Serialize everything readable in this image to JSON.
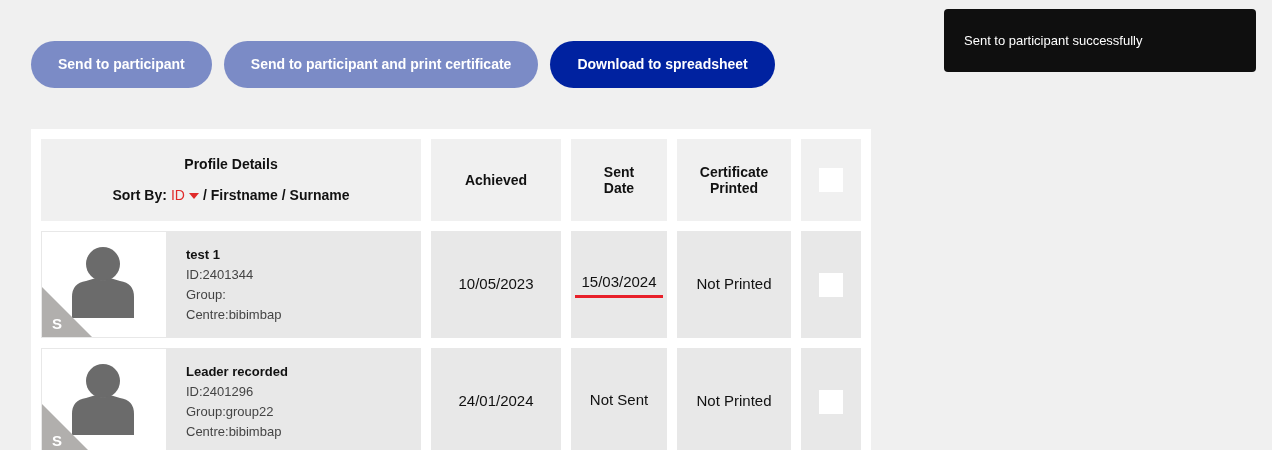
{
  "toolbar": {
    "buttons": [
      {
        "label": "Send to participant",
        "disabled": true
      },
      {
        "label": "Send to participant and print certificate",
        "disabled": true
      },
      {
        "label": "Download to spreadsheet",
        "disabled": false
      }
    ]
  },
  "toast": {
    "message": "Sent to participant successfully"
  },
  "table": {
    "header": {
      "profile_title": "Profile Details",
      "sort_label": "Sort By:",
      "sort_options": [
        {
          "label": "ID",
          "selected": true
        },
        {
          "label": "Firstname",
          "selected": false
        },
        {
          "label": "Surname",
          "selected": false
        }
      ],
      "separator": "/",
      "achieved": "Achieved",
      "sent_date": "Sent Date",
      "certificate_printed": "Certificate Printed",
      "select_all_checked": false
    },
    "rows": [
      {
        "avatar_badge": "S",
        "name": "test 1",
        "id": "ID:2401344",
        "group": "Group:",
        "centre": "Centre:bibimbap",
        "achieved": "10/05/2023",
        "sent_date": "15/03/2024",
        "sent_date_underlined": true,
        "certificate": "Not Printed",
        "checked": false
      },
      {
        "avatar_badge": "S",
        "name": "Leader recorded",
        "id": "ID:2401296",
        "group": "Group:group22",
        "centre": "Centre:bibimbap",
        "achieved": "24/01/2024",
        "sent_date": "Not Sent",
        "sent_date_underlined": false,
        "certificate": "Not Printed",
        "checked": false
      }
    ]
  }
}
